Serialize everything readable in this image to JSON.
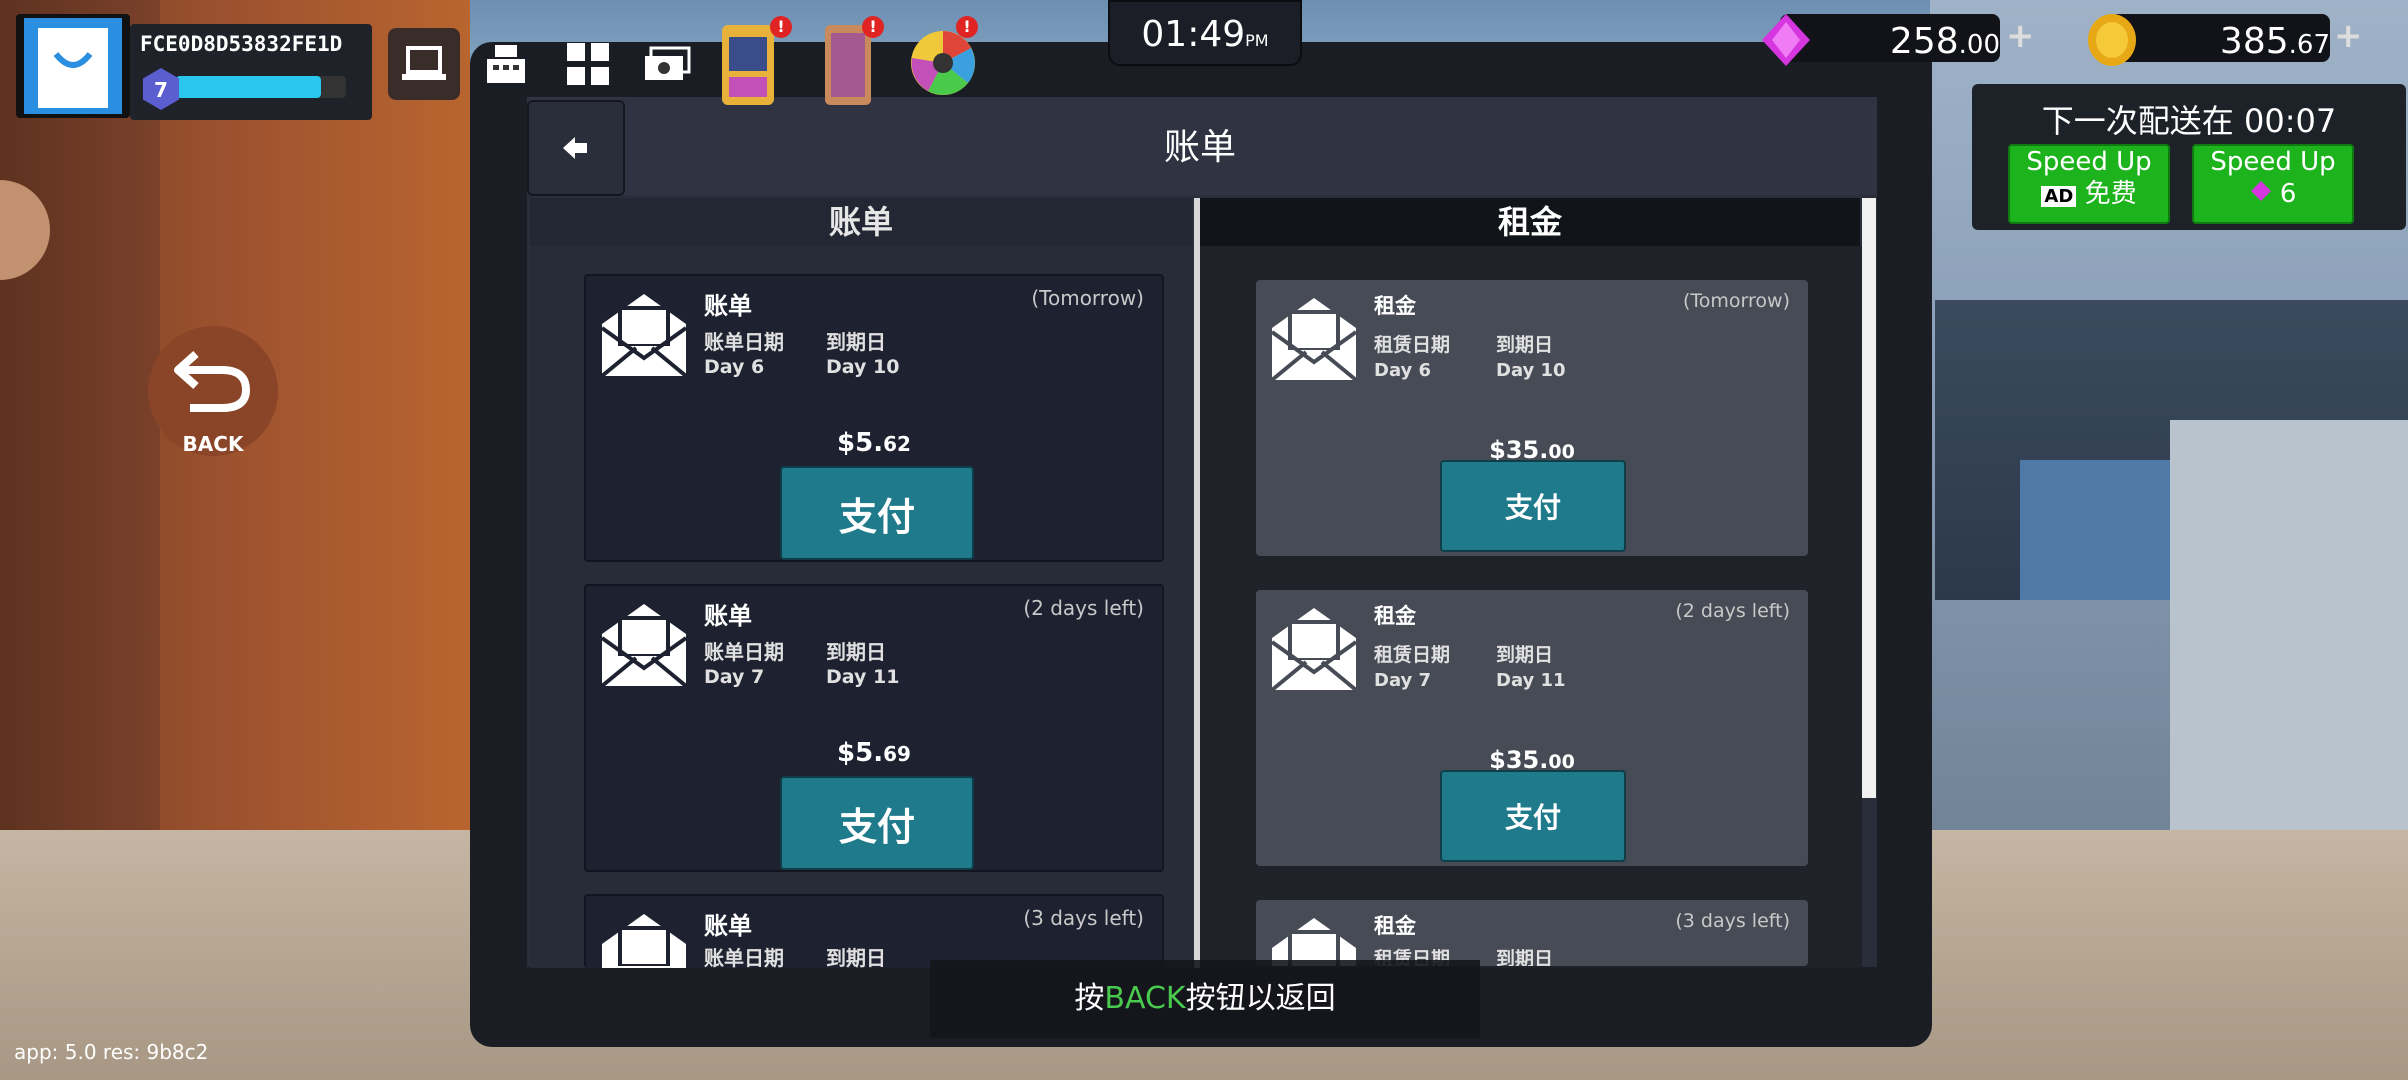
{
  "player": {
    "id": "FCE0D8D53832FE1D",
    "level": "7",
    "xp_fraction": 0.85
  },
  "clock": {
    "time": "01:49",
    "ampm": "PM"
  },
  "currencies": {
    "gems": {
      "main": "258",
      "decimal": ".00"
    },
    "coins": {
      "main": "385",
      "decimal": ".67"
    }
  },
  "toolbar_badge": "!",
  "delivery": {
    "text": "下一次配送在 00:07",
    "speed_up_ad": {
      "line1": "Speed Up",
      "line2": "免费",
      "ad_label": "AD"
    },
    "speed_up_gem": {
      "line1": "Speed Up",
      "line2": "6"
    }
  },
  "side_back": {
    "label": "BACK"
  },
  "screen": {
    "title": "账单"
  },
  "columns": {
    "bills": "账单",
    "rent": "租金"
  },
  "bills": [
    {
      "title": "账单",
      "due": "(Tomorrow)",
      "label1": "账单日期",
      "label2": "到期日",
      "value1": "Day 6",
      "value2": "Day 10",
      "amount_main": "$5.",
      "amount_dec": "62",
      "pay": "支付"
    },
    {
      "title": "账单",
      "due": "(2 days left)",
      "label1": "账单日期",
      "label2": "到期日",
      "value1": "Day 7",
      "value2": "Day 11",
      "amount_main": "$5.",
      "amount_dec": "69",
      "pay": "支付"
    },
    {
      "title": "账单",
      "due": "(3 days left)",
      "label1": "账单日期",
      "label2": "到期日"
    }
  ],
  "rents": [
    {
      "title": "租金",
      "due": "(Tomorrow)",
      "label1": "租赁日期",
      "label2": "到期日",
      "value1": "Day 6",
      "value2": "Day 10",
      "amount_main": "$35.",
      "amount_dec": "00",
      "pay": "支付"
    },
    {
      "title": "租金",
      "due": "(2 days left)",
      "label1": "租赁日期",
      "label2": "到期日",
      "value1": "Day 7",
      "value2": "Day 11",
      "amount_main": "$35.",
      "amount_dec": "00",
      "pay": "支付"
    },
    {
      "title": "租金",
      "due": "(3 days left)",
      "label1": "租赁日期",
      "label2": "到期日"
    }
  ],
  "hint": {
    "prefix": "按",
    "key": "BACK",
    "suffix": "按钮以返回"
  },
  "debug": "app: 5.0 res: 9b8c2",
  "colors": {
    "accent_button": "#1f7a8c",
    "speed_up": "#1db31d",
    "xp_bar": "#29c6ee"
  }
}
